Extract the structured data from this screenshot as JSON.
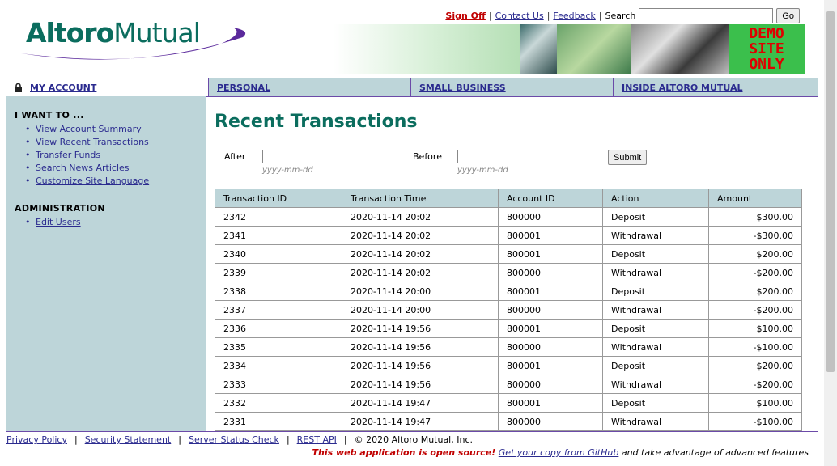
{
  "logo": {
    "part1": "Altoro",
    "part2": "Mutual"
  },
  "toplinks": {
    "sign_off": "Sign Off",
    "contact": "Contact Us",
    "feedback": "Feedback",
    "search_label": "Search",
    "go": "Go",
    "search_value": ""
  },
  "banner": {
    "demo_line1": "DEMO",
    "demo_line2": "SITE",
    "demo_line3": "ONLY"
  },
  "nav": {
    "my_account": "MY ACCOUNT",
    "personal": "PERSONAL",
    "small_business": "SMALL BUSINESS",
    "inside": "INSIDE ALTORO MUTUAL"
  },
  "sidebar": {
    "i_want_to": "I WANT TO ...",
    "items": [
      "View Account Summary",
      "View Recent Transactions",
      "Transfer Funds",
      "Search News Articles",
      "Customize Site Language"
    ],
    "administration": "ADMINISTRATION",
    "admin_items": [
      "Edit Users"
    ]
  },
  "main": {
    "title": "Recent Transactions",
    "after_label": "After",
    "before_label": "Before",
    "date_hint": "yyyy-mm-dd",
    "submit": "Submit",
    "after_value": "",
    "before_value": ""
  },
  "table": {
    "headers": [
      "Transaction ID",
      "Transaction Time",
      "Account ID",
      "Action",
      "Amount"
    ],
    "rows": [
      [
        "2342",
        "2020-11-14 20:02",
        "800000",
        "Deposit",
        "$300.00"
      ],
      [
        "2341",
        "2020-11-14 20:02",
        "800001",
        "Withdrawal",
        "-$300.00"
      ],
      [
        "2340",
        "2020-11-14 20:02",
        "800001",
        "Deposit",
        "$200.00"
      ],
      [
        "2339",
        "2020-11-14 20:02",
        "800000",
        "Withdrawal",
        "-$200.00"
      ],
      [
        "2338",
        "2020-11-14 20:00",
        "800001",
        "Deposit",
        "$200.00"
      ],
      [
        "2337",
        "2020-11-14 20:00",
        "800000",
        "Withdrawal",
        "-$200.00"
      ],
      [
        "2336",
        "2020-11-14 19:56",
        "800001",
        "Deposit",
        "$100.00"
      ],
      [
        "2335",
        "2020-11-14 19:56",
        "800000",
        "Withdrawal",
        "-$100.00"
      ],
      [
        "2334",
        "2020-11-14 19:56",
        "800001",
        "Deposit",
        "$200.00"
      ],
      [
        "2333",
        "2020-11-14 19:56",
        "800000",
        "Withdrawal",
        "-$200.00"
      ],
      [
        "2332",
        "2020-11-14 19:47",
        "800001",
        "Deposit",
        "$100.00"
      ],
      [
        "2331",
        "2020-11-14 19:47",
        "800000",
        "Withdrawal",
        "-$100.00"
      ]
    ]
  },
  "footer": {
    "privacy": "Privacy Policy",
    "security": "Security Statement",
    "server_status": "Server Status Check",
    "rest_api": "REST API",
    "copyright": "© 2020 Altoro Mutual, Inc.",
    "open_source": "This web application is open source!",
    "github_link": "Get your copy from GitHub",
    "tail": "and take advantage of advanced features"
  },
  "colors": {
    "brand_green": "#0b6d5e",
    "nav_bg": "#bdd5d9",
    "accent_purple": "#6b4aa8",
    "link": "#2b2b8f",
    "alert_red": "#c00000"
  }
}
